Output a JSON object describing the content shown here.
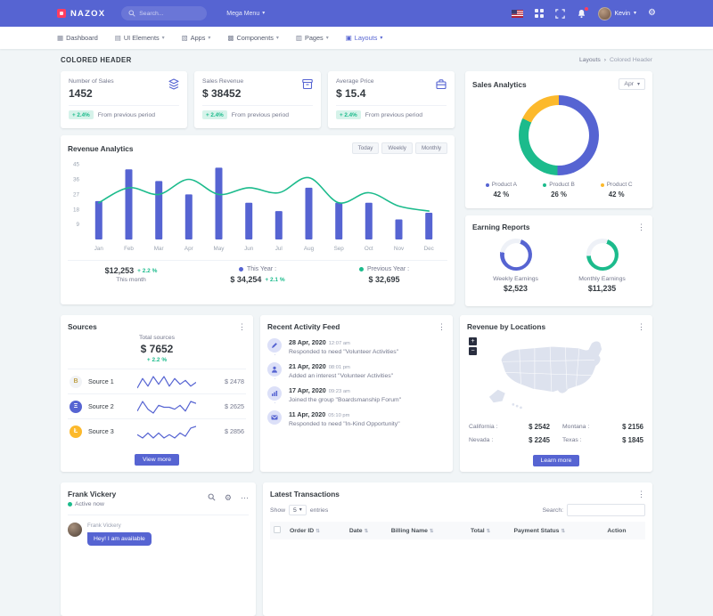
{
  "colors": {
    "primary": "#5664d2",
    "success": "#1cbb8c",
    "warning": "#fcb92c",
    "danger": "#ff3d60",
    "body_bg": "#f1f5f7"
  },
  "icons": {
    "chevron_down": "▾",
    "kebab": "⋮",
    "ellipsis": "⋯",
    "breadcrumb_sep": "›",
    "sort": "⇅",
    "zoom_in": "+",
    "zoom_out": "−",
    "gear": "⚙"
  },
  "topbar": {
    "logo": "NAZOX",
    "search_placeholder": "Search...",
    "mega_menu_label": "Mega Menu",
    "user_name": "Kevin"
  },
  "nav": {
    "items": [
      {
        "label": "Dashboard"
      },
      {
        "label": "UI Elements"
      },
      {
        "label": "Apps"
      },
      {
        "label": "Components"
      },
      {
        "label": "Pages"
      },
      {
        "label": "Layouts"
      }
    ]
  },
  "page": {
    "title": "COLORED HEADER",
    "breadcrumb": {
      "parent": "Layouts",
      "current": "Colored Header"
    }
  },
  "stats": [
    {
      "label": "Number of Sales",
      "value": "1452",
      "badge": "+ 2.4%",
      "note": "From previous period",
      "icon": "layers-icon"
    },
    {
      "label": "Sales Revenue",
      "value": "$ 38452",
      "badge": "+ 2.4%",
      "note": "From previous period",
      "icon": "archive-icon"
    },
    {
      "label": "Average Price",
      "value": "$ 15.4",
      "badge": "+ 2.4%",
      "note": "From previous period",
      "icon": "briefcase-icon"
    }
  ],
  "revenue": {
    "title": "Revenue Analytics",
    "range_buttons": [
      "Today",
      "Weekly",
      "Monthly"
    ],
    "month": {
      "value": "$12,253",
      "badge": "+ 2.2 %",
      "label": "This month"
    },
    "this_year": {
      "label": "This Year :",
      "value": "$ 34,254",
      "badge": "+ 2.1 %"
    },
    "previous_year": {
      "label": "Previous Year :",
      "value": "$ 32,695"
    }
  },
  "sales_analytics": {
    "title": "Sales Analytics",
    "period": "Apr",
    "legend": [
      {
        "name": "Product A",
        "pct": "42 %"
      },
      {
        "name": "Product B",
        "pct": "26 %"
      },
      {
        "name": "Product C",
        "pct": "42 %"
      }
    ]
  },
  "earning": {
    "title": "Earning Reports",
    "items": [
      {
        "label": "Weekly Earnings",
        "value": "$2,523",
        "progress": 72
      },
      {
        "label": "Monthly Earnings",
        "value": "$11,235",
        "progress": 68
      }
    ]
  },
  "sources": {
    "title": "Sources",
    "total_label": "Total sources",
    "total_value": "$ 7652",
    "total_badge": "+ 2.2 %",
    "view_more_label": "View more",
    "rows": [
      {
        "name": "Source 1",
        "value": "$ 2478",
        "symbol": "B",
        "spark": [
          3,
          8,
          4,
          9,
          5,
          9,
          4,
          8,
          5,
          7,
          4,
          6
        ]
      },
      {
        "name": "Source 2",
        "value": "$ 2625",
        "symbol": "Ξ",
        "spark": [
          4,
          9,
          5,
          3,
          7,
          6,
          6,
          5,
          7,
          4,
          9,
          8
        ]
      },
      {
        "name": "Source 3",
        "value": "$ 2856",
        "symbol": "Ł",
        "spark": [
          5,
          3,
          6,
          3,
          6,
          3,
          5,
          3,
          6,
          4,
          9,
          10
        ]
      }
    ]
  },
  "activity": {
    "title": "Recent Activity Feed",
    "items": [
      {
        "date": "28 Apr, 2020",
        "time": "12:07 am",
        "text": "Responded to need \"Volunteer Activities\"",
        "icon": "pencil-icon"
      },
      {
        "date": "21 Apr, 2020",
        "time": "08:01 pm",
        "text": "Added an interest \"Volunteer Activities\"",
        "icon": "user-icon"
      },
      {
        "date": "17 Apr, 2020",
        "time": "09:23 am",
        "text": "Joined the group \"Boardsmanship Forum\"",
        "icon": "chart-icon"
      },
      {
        "date": "11 Apr, 2020",
        "time": "05:10 pm",
        "text": "Responded to need \"In-Kind Opportunity\"",
        "icon": "mail-icon"
      }
    ]
  },
  "locations": {
    "title": "Revenue by Locations",
    "rows": [
      {
        "name": "California :",
        "value": "$ 2542"
      },
      {
        "name": "Montana :",
        "value": "$ 2156"
      },
      {
        "name": "Nevada :",
        "value": "$ 2245"
      },
      {
        "name": "Texas :",
        "value": "$ 1845"
      }
    ],
    "button_label": "Learn more"
  },
  "chat": {
    "name": "Frank Vickery",
    "status": "Active now",
    "sender": "Frank Vickery",
    "message": "Hey! I am available"
  },
  "transactions": {
    "title": "Latest Transactions",
    "show_label": "Show",
    "entries_value": "5",
    "entries_label": "entries",
    "search_label": "Search:",
    "columns": [
      "Order ID",
      "Date",
      "Billing Name",
      "Total",
      "Payment Status",
      "Action"
    ]
  },
  "chart_data": [
    {
      "type": "bar",
      "title": "Revenue Analytics",
      "categories": [
        "Jan",
        "Feb",
        "Mar",
        "Apr",
        "May",
        "Jun",
        "Jul",
        "Aug",
        "Sep",
        "Oct",
        "Nov",
        "Dec"
      ],
      "series": [
        {
          "name": "This Year",
          "type": "column",
          "color": "#5664d2",
          "values": [
            23,
            42,
            35,
            27,
            43,
            22,
            17,
            31,
            22,
            22,
            12,
            16
          ]
        },
        {
          "name": "Previous Year",
          "type": "line",
          "color": "#1cbb8c",
          "values": [
            22,
            31,
            27,
            36,
            27,
            31,
            28,
            37,
            22,
            28,
            20,
            17
          ]
        }
      ],
      "ylim": [
        0,
        48
      ],
      "yticks": [
        9,
        18,
        27,
        36,
        45
      ],
      "legend_position": "bottom"
    },
    {
      "type": "pie",
      "title": "Sales Analytics",
      "labels": [
        "Product A",
        "Product B",
        "Product C"
      ],
      "values": [
        42,
        26,
        15
      ],
      "display_pcts": [
        "42 %",
        "26 %",
        "42 %"
      ],
      "colors": [
        "#5664d2",
        "#1cbb8c",
        "#fcb92c"
      ],
      "donut": true
    }
  ]
}
